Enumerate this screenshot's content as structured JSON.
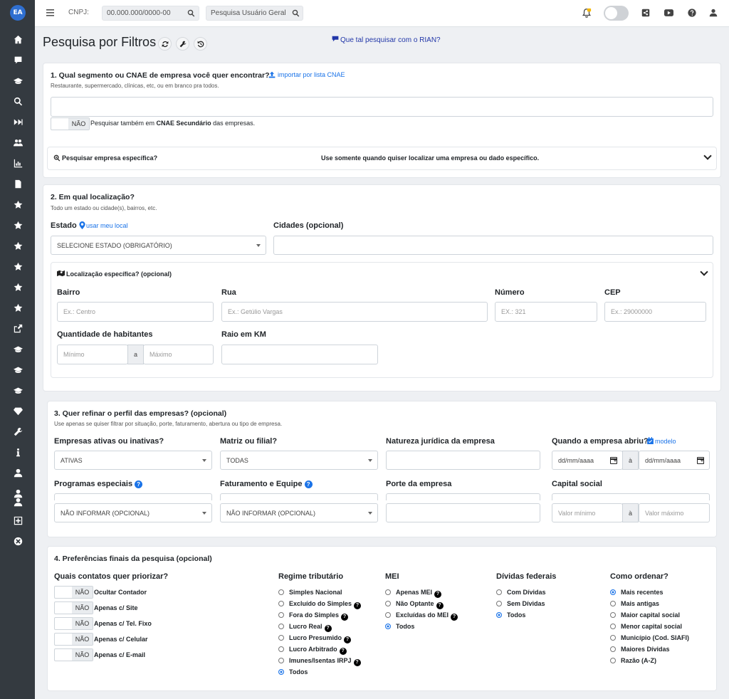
{
  "app": {
    "logo_text": "EA",
    "brand_color": "#2f6fd0"
  },
  "topbar": {
    "cnpj_label": "CNPJ:",
    "cnpj_placeholder": "00.000.000/0000-00",
    "user_search_placeholder": "Pesquisa Usuário Geral"
  },
  "header": {
    "title": "Pesquisa por Filtros",
    "rian_link": "Que tal pesquisar com o RIAN?"
  },
  "section1": {
    "title": "1. Qual segmento ou CNAE de empresa você quer encontrar?",
    "import_link": "importar por lista CNAE",
    "subtitle": "Restaurante, supermercado, clínicas, etc, ou em branco pra todos.",
    "toggle_label": "NÃO",
    "secondary_prefix": "Pesquisar também em ",
    "secondary_bold": "CNAE Secundário",
    "secondary_suffix": " das empresas."
  },
  "specific": {
    "title": "Pesquisar empresa específica?",
    "hint": "Use somente quando quiser localizar uma empresa ou dado específico."
  },
  "section2": {
    "title": "2. Em qual localização?",
    "subtitle": "Todo um estado ou cidade(s), bairros, etc.",
    "estado_label": "Estado",
    "use_location_link": "usar meu local",
    "estado_value": "SELECIONE ESTADO (OBRIGATÓRIO)",
    "cidades_label": "Cidades (opcional)",
    "specific_title": "Localização específica? (opcional)",
    "bairro_label": "Bairro",
    "bairro_placeholder": "Ex.: Centro",
    "rua_label": "Rua",
    "rua_placeholder": "Ex.: Getúlio Vargas",
    "numero_label": "Número",
    "numero_placeholder": "EX.: 321",
    "cep_label": "CEP",
    "cep_placeholder": "Ex.: 29000000",
    "habitantes_label": "Quantidade de habitantes",
    "min_placeholder": "Mínimo",
    "range_sep": "a",
    "max_placeholder": "Máximo",
    "raio_label": "Raio em KM"
  },
  "section3": {
    "title": "3. Quer refinar o perfil das empresas? (opcional)",
    "subtitle": "Use apenas se quiser filtrar por situação, porte, faturamento, abertura ou tipo de empresa.",
    "ativas_label": "Empresas ativas ou inativas?",
    "ativas_value": "ATIVAS",
    "matriz_label": "Matriz ou filial?",
    "matriz_value": "TODAS",
    "natureza_label": "Natureza jurídica da empresa",
    "abertura_label": "Quando a empresa abriu?",
    "modelo_link": "modelo",
    "date_placeholder": "dd/mm/aaaa",
    "date_sep": "à",
    "programas_label": "Programas especiais",
    "programas_value": "NÃO INFORMAR (OPCIONAL)",
    "faturamento_label": "Faturamento e Equipe",
    "faturamento_value": "NÃO INFORMAR (OPCIONAL)",
    "porte_label": "Porte da empresa",
    "capital_label": "Capital social",
    "capital_min": "Valor mínimo",
    "capital_sep": "à",
    "capital_max": "Valor máximo"
  },
  "section4": {
    "title": "4. Preferências finais da pesquisa (opcional)",
    "contatos_label": "Quais contatos quer priorizar?",
    "toggle_text": "NÃO",
    "contatos": [
      "Ocultar Contador",
      "Apenas c/ Site",
      "Apenas c/ Tel. Fixo",
      "Apenas c/ Celular",
      "Apenas c/ E-mail"
    ],
    "regime_label": "Regime tributário",
    "regime": [
      {
        "label": "Simples Nacional",
        "help": false,
        "checked": false
      },
      {
        "label": "Excluído do Simples",
        "help": true,
        "checked": false
      },
      {
        "label": "Fora do Simples",
        "help": true,
        "checked": false
      },
      {
        "label": "Lucro Real",
        "help": true,
        "checked": false
      },
      {
        "label": "Lucro Presumido",
        "help": true,
        "checked": false
      },
      {
        "label": "Lucro Arbitrado",
        "help": true,
        "checked": false
      },
      {
        "label": "Imunes/Isentas IRPJ",
        "help": true,
        "checked": false
      },
      {
        "label": "Todos",
        "help": false,
        "checked": true
      }
    ],
    "mei_label": "MEI",
    "mei": [
      {
        "label": "Apenas MEI",
        "help": true,
        "checked": false
      },
      {
        "label": "Não Optante",
        "help": true,
        "checked": false
      },
      {
        "label": "Excluídas do MEI",
        "help": true,
        "checked": false
      },
      {
        "label": "Todos",
        "help": false,
        "checked": true
      }
    ],
    "dividas_label": "Dívidas federais",
    "dividas": [
      {
        "label": "Com Dívidas",
        "checked": false
      },
      {
        "label": "Sem Dívidas",
        "checked": false
      },
      {
        "label": "Todos",
        "checked": true
      }
    ],
    "ordenar_label": "Como ordenar?",
    "ordenar": [
      {
        "label": "Mais recentes",
        "checked": true
      },
      {
        "label": "Mais antigas",
        "checked": false
      },
      {
        "label": "Maior capital social",
        "checked": false
      },
      {
        "label": "Menor capital social",
        "checked": false
      },
      {
        "label": "Município (Cod. SIAFI)",
        "checked": false
      },
      {
        "label": "Maiores Dívidas",
        "checked": false
      },
      {
        "label": "Razão (A-Z)",
        "checked": false
      }
    ]
  }
}
